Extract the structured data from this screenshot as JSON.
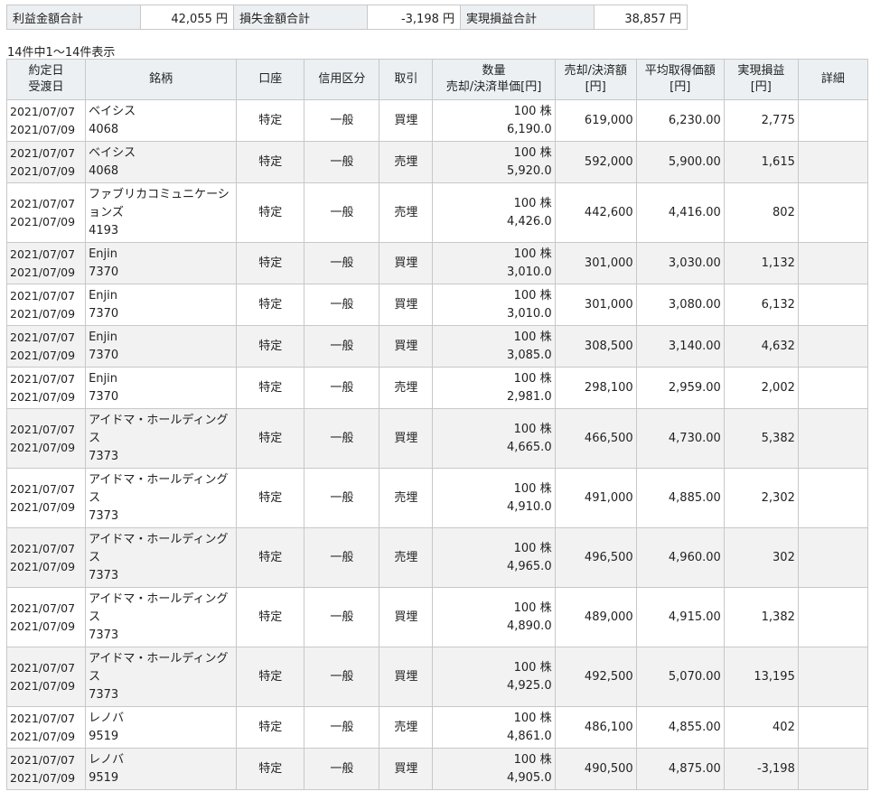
{
  "summary": {
    "profit_label": "利益金額合計",
    "profit_value": "42,055 円",
    "loss_label": "損失金額合計",
    "loss_value": "-3,198 円",
    "realized_label": "実現損益合計",
    "realized_value": "38,857 円"
  },
  "count_text": "14件中1～14件表示",
  "headers": {
    "date_1": "約定日",
    "date_2": "受渡日",
    "name": "銘柄",
    "account": "口座",
    "credit": "信用区分",
    "trade": "取引",
    "qty_1": "数量",
    "qty_2": "売却/決済単価[円]",
    "amount_1": "売却/決済額",
    "amount_2": "[円]",
    "avg_1": "平均取得価額",
    "avg_2": "[円]",
    "pnl_1": "実現損益",
    "pnl_2": "[円]",
    "detail": "詳細"
  },
  "rows": [
    {
      "trade_date": "2021/07/07",
      "settle_date": "2021/07/09",
      "name": "ベイシス",
      "code": "4068",
      "account": "特定",
      "credit": "一般",
      "trade": "買埋",
      "qty": "100 株",
      "price": "6,190.0",
      "amount": "619,000",
      "avg": "6,230.00",
      "pnl": "2,775"
    },
    {
      "trade_date": "2021/07/07",
      "settle_date": "2021/07/09",
      "name": "ベイシス",
      "code": "4068",
      "account": "特定",
      "credit": "一般",
      "trade": "売埋",
      "qty": "100 株",
      "price": "5,920.0",
      "amount": "592,000",
      "avg": "5,900.00",
      "pnl": "1,615"
    },
    {
      "trade_date": "2021/07/07",
      "settle_date": "2021/07/09",
      "name": "ファブリカコミュニケーションズ",
      "code": "4193",
      "account": "特定",
      "credit": "一般",
      "trade": "売埋",
      "qty": "100 株",
      "price": "4,426.0",
      "amount": "442,600",
      "avg": "4,416.00",
      "pnl": "802"
    },
    {
      "trade_date": "2021/07/07",
      "settle_date": "2021/07/09",
      "name": "Enjin",
      "code": "7370",
      "account": "特定",
      "credit": "一般",
      "trade": "買埋",
      "qty": "100 株",
      "price": "3,010.0",
      "amount": "301,000",
      "avg": "3,030.00",
      "pnl": "1,132"
    },
    {
      "trade_date": "2021/07/07",
      "settle_date": "2021/07/09",
      "name": "Enjin",
      "code": "7370",
      "account": "特定",
      "credit": "一般",
      "trade": "買埋",
      "qty": "100 株",
      "price": "3,010.0",
      "amount": "301,000",
      "avg": "3,080.00",
      "pnl": "6,132"
    },
    {
      "trade_date": "2021/07/07",
      "settle_date": "2021/07/09",
      "name": "Enjin",
      "code": "7370",
      "account": "特定",
      "credit": "一般",
      "trade": "買埋",
      "qty": "100 株",
      "price": "3,085.0",
      "amount": "308,500",
      "avg": "3,140.00",
      "pnl": "4,632"
    },
    {
      "trade_date": "2021/07/07",
      "settle_date": "2021/07/09",
      "name": "Enjin",
      "code": "7370",
      "account": "特定",
      "credit": "一般",
      "trade": "売埋",
      "qty": "100 株",
      "price": "2,981.0",
      "amount": "298,100",
      "avg": "2,959.00",
      "pnl": "2,002"
    },
    {
      "trade_date": "2021/07/07",
      "settle_date": "2021/07/09",
      "name": "アイドマ・ホールディングス",
      "code": "7373",
      "account": "特定",
      "credit": "一般",
      "trade": "買埋",
      "qty": "100 株",
      "price": "4,665.0",
      "amount": "466,500",
      "avg": "4,730.00",
      "pnl": "5,382"
    },
    {
      "trade_date": "2021/07/07",
      "settle_date": "2021/07/09",
      "name": "アイドマ・ホールディングス",
      "code": "7373",
      "account": "特定",
      "credit": "一般",
      "trade": "売埋",
      "qty": "100 株",
      "price": "4,910.0",
      "amount": "491,000",
      "avg": "4,885.00",
      "pnl": "2,302"
    },
    {
      "trade_date": "2021/07/07",
      "settle_date": "2021/07/09",
      "name": "アイドマ・ホールディングス",
      "code": "7373",
      "account": "特定",
      "credit": "一般",
      "trade": "売埋",
      "qty": "100 株",
      "price": "4,965.0",
      "amount": "496,500",
      "avg": "4,960.00",
      "pnl": "302"
    },
    {
      "trade_date": "2021/07/07",
      "settle_date": "2021/07/09",
      "name": "アイドマ・ホールディングス",
      "code": "7373",
      "account": "特定",
      "credit": "一般",
      "trade": "買埋",
      "qty": "100 株",
      "price": "4,890.0",
      "amount": "489,000",
      "avg": "4,915.00",
      "pnl": "1,382"
    },
    {
      "trade_date": "2021/07/07",
      "settle_date": "2021/07/09",
      "name": "アイドマ・ホールディングス",
      "code": "7373",
      "account": "特定",
      "credit": "一般",
      "trade": "買埋",
      "qty": "100 株",
      "price": "4,925.0",
      "amount": "492,500",
      "avg": "5,070.00",
      "pnl": "13,195"
    },
    {
      "trade_date": "2021/07/07",
      "settle_date": "2021/07/09",
      "name": "レノバ",
      "code": "9519",
      "account": "特定",
      "credit": "一般",
      "trade": "売埋",
      "qty": "100 株",
      "price": "4,861.0",
      "amount": "486,100",
      "avg": "4,855.00",
      "pnl": "402"
    },
    {
      "trade_date": "2021/07/07",
      "settle_date": "2021/07/09",
      "name": "レノバ",
      "code": "9519",
      "account": "特定",
      "credit": "一般",
      "trade": "買埋",
      "qty": "100 株",
      "price": "4,905.0",
      "amount": "490,500",
      "avg": "4,875.00",
      "pnl": "-3,198"
    }
  ]
}
